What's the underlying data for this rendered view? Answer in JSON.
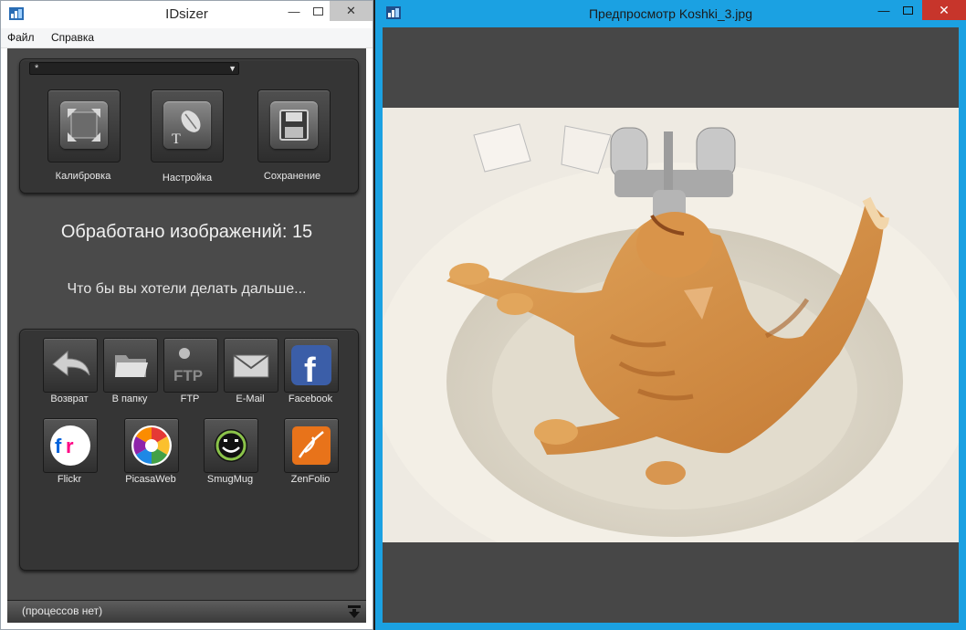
{
  "left_window": {
    "title": "IDsizer",
    "menu": [
      "Файл",
      "Справка"
    ],
    "combo_value": "*",
    "main_actions": [
      {
        "label": "Калибровка",
        "icon": "calibration-icon"
      },
      {
        "label": "Настройка",
        "icon": "settings-icon"
      },
      {
        "label": "Сохранение",
        "icon": "save-icon"
      }
    ],
    "processed_text": "Обработано изображений: 15",
    "next_text": "Что бы вы хотели делать дальше...",
    "share_actions": [
      {
        "label": "Возврат",
        "icon": "back-arrow-icon"
      },
      {
        "label": "В папку",
        "icon": "folder-icon"
      },
      {
        "label": "FTP",
        "icon": "ftp-icon"
      },
      {
        "label": "E-Mail",
        "icon": "email-icon"
      },
      {
        "label": "Facebook",
        "icon": "facebook-icon"
      },
      {
        "label": "Flickr",
        "icon": "flickr-icon"
      },
      {
        "label": "PicasaWeb",
        "icon": "picasa-icon"
      },
      {
        "label": "SmugMug",
        "icon": "smugmug-icon"
      },
      {
        "label": "ZenFolio",
        "icon": "zenfolio-icon"
      }
    ],
    "status": "(процессов нет)"
  },
  "right_window": {
    "title": "Предпросмотр Koshki_3.jpg"
  },
  "colors": {
    "accent_border": "#1ba1e2",
    "close_button": "#c7352b",
    "panel": "#353535",
    "client": "#4a4a4a"
  }
}
